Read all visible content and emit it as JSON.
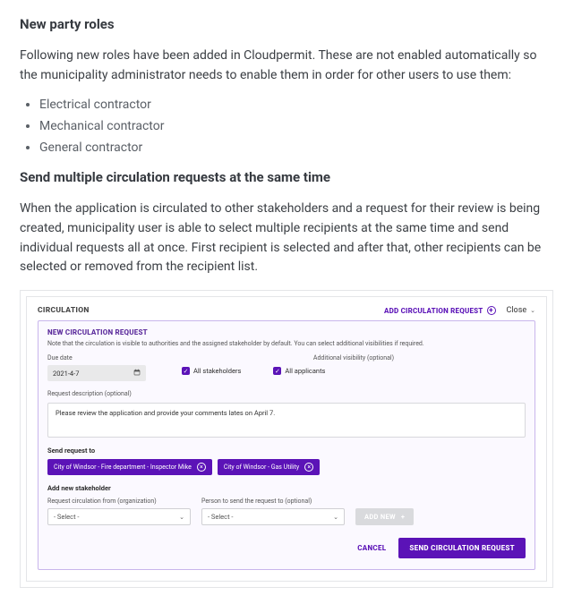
{
  "section1_title": "New party roles",
  "section1_intro": "Following new roles have been added in Cloudpermit. These are not enabled automatically so the municipality administrator needs to enable them in order for other users to use them:",
  "roles": [
    "Electrical contractor",
    "Mechanical contractor",
    "General contractor"
  ],
  "section2_title": "Send multiple circulation requests at the same time",
  "section2_body": "When the application is circulated to other stakeholders and a request for their review is being created, municipality user is able to select multiple recipients at the same time and send individual requests all at once. First recipient is selected and after that, other recipients can be selected or removed from the recipient list.",
  "circ": {
    "panel_title": "CIRCULATION",
    "add_req": "ADD CIRCULATION REQUEST",
    "close": "Close",
    "box": {
      "title": "NEW CIRCULATION REQUEST",
      "note": "Note that the circulation is visible to authorities and the assigned stakeholder by default. You can select additional visibilities if required.",
      "due_date_label": "Due date",
      "due_date_value": "2021-4-7",
      "visibility_label": "Additional visibility (optional)",
      "vis1": "All stakeholders",
      "vis2": "All applicants",
      "desc_label": "Request description (optional)",
      "desc_value": "Please review the application and provide your comments lates on April 7.",
      "send_to_label": "Send request to",
      "chips": [
        "City of Windsor - Fire department - Inspector Mike",
        "City of Windsor - Gas Utility"
      ],
      "add_stakeholder_label": "Add new stakeholder",
      "org_label": "Request circulation from (organization)",
      "person_label": "Person to send the request to (optional)",
      "select_placeholder": "- Select -",
      "addnew_btn": "ADD NEW",
      "cancel": "CANCEL",
      "send": "SEND CIRCULATION REQUEST"
    }
  }
}
